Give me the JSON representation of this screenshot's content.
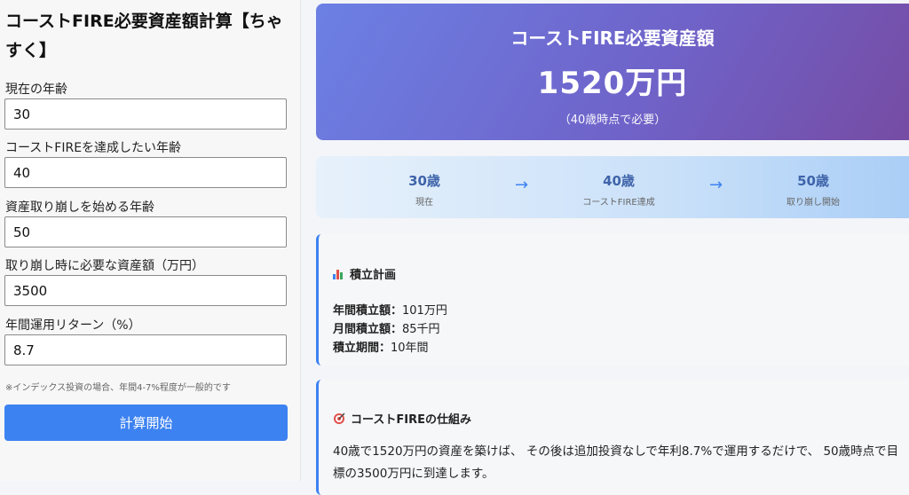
{
  "app_title": "コーストFIRE必要資産額計算【ちゃすく】",
  "form": {
    "fields": [
      {
        "label": "現在の年齢",
        "value": "30"
      },
      {
        "label": "コーストFIREを達成したい年齢",
        "value": "40"
      },
      {
        "label": "資産取り崩しを始める年齢",
        "value": "50"
      },
      {
        "label": "取り崩し時に必要な資産額（万円）",
        "value": "3500"
      },
      {
        "label": "年間運用リターン（%）",
        "value": "8.7"
      }
    ],
    "note": "※インデックス投資の場合、年間4-7%程度が一般的です",
    "button_label": "計算開始"
  },
  "result": {
    "title": "コーストFIRE必要資産額",
    "amount": "1520万円",
    "sub": "（40歳時点で必要）"
  },
  "timeline": {
    "arrow": "→",
    "steps": [
      {
        "age": "30歳",
        "caption": "現在"
      },
      {
        "age": "40歳",
        "caption": "コーストFIRE達成"
      },
      {
        "age": "50歳",
        "caption": "取り崩し開始"
      }
    ]
  },
  "plan": {
    "title": "積立計画",
    "icon": "bar-chart-icon",
    "lines": [
      {
        "label": "年間積立額：",
        "value": "101万円"
      },
      {
        "label": "月間積立額：",
        "value": "85千円"
      },
      {
        "label": "積立期間：",
        "value": "10年間"
      }
    ]
  },
  "mechanism": {
    "title": "コーストFIREの仕組み",
    "icon": "target-icon",
    "text": "40歳で1520万円の資産を築けば、 その後は追加投資なしで年利8.7%で運用するだけで、 50歳時点で目標の3500万円に到達します。"
  },
  "colors": {
    "accent": "#3d82f1",
    "gradient_start": "#6c80e4",
    "gradient_end": "#764ba2"
  }
}
